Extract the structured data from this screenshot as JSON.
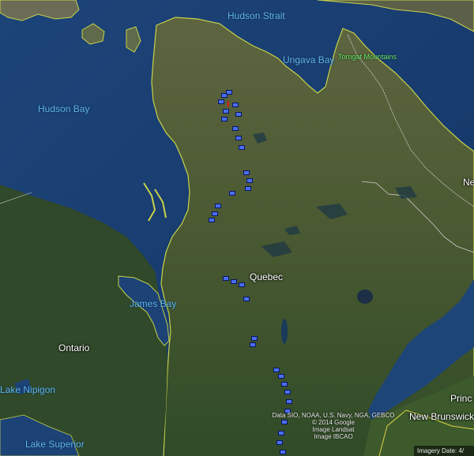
{
  "map": {
    "water_labels": {
      "hudson_strait": "Hudson Strait",
      "ungava_bay": "Ungava Bay",
      "hudson_bay": "Hudson Bay",
      "james_bay": "James Bay",
      "lake_nipigon": "Lake Nipigon",
      "lake_superior": "Lake Superior"
    },
    "region_labels": {
      "quebec": "Quebec",
      "ontario": "Ontario",
      "newfoundland_partial": "Ne",
      "pei_partial": "Princ",
      "new_brunswick": "New Brunswick"
    },
    "feature_labels": {
      "torngat_mountains": "Torngat Mountains"
    },
    "attribution": {
      "line1": "Data SIO, NOAA, U.S. Navy, NGA, GEBCO",
      "line2": "© 2014 Google",
      "line3": "Image Landsat",
      "line4": "Image IBCAO"
    },
    "imagery_date": "Imagery Date: 4/"
  },
  "colors": {
    "water": "#173a6b",
    "land_north": "#4f5a34",
    "land_south": "#2f4a26",
    "coastline": "#c8d24a",
    "marker": "#4a6ef0",
    "label_water": "#5fb6e8"
  },
  "icons": {
    "marker": "placemark-square-icon",
    "pin": "red-pin-icon"
  }
}
